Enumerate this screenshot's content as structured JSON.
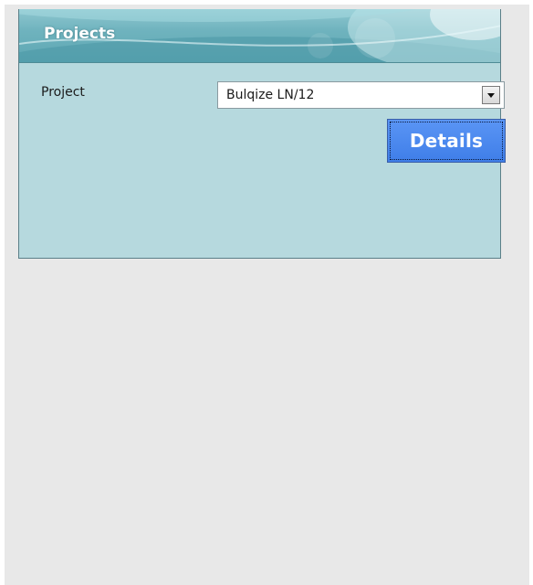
{
  "panel": {
    "title": "Projects",
    "project_label": "Project",
    "project_select": {
      "value": "Bulqize LN/12"
    },
    "details_button": "Details"
  }
}
